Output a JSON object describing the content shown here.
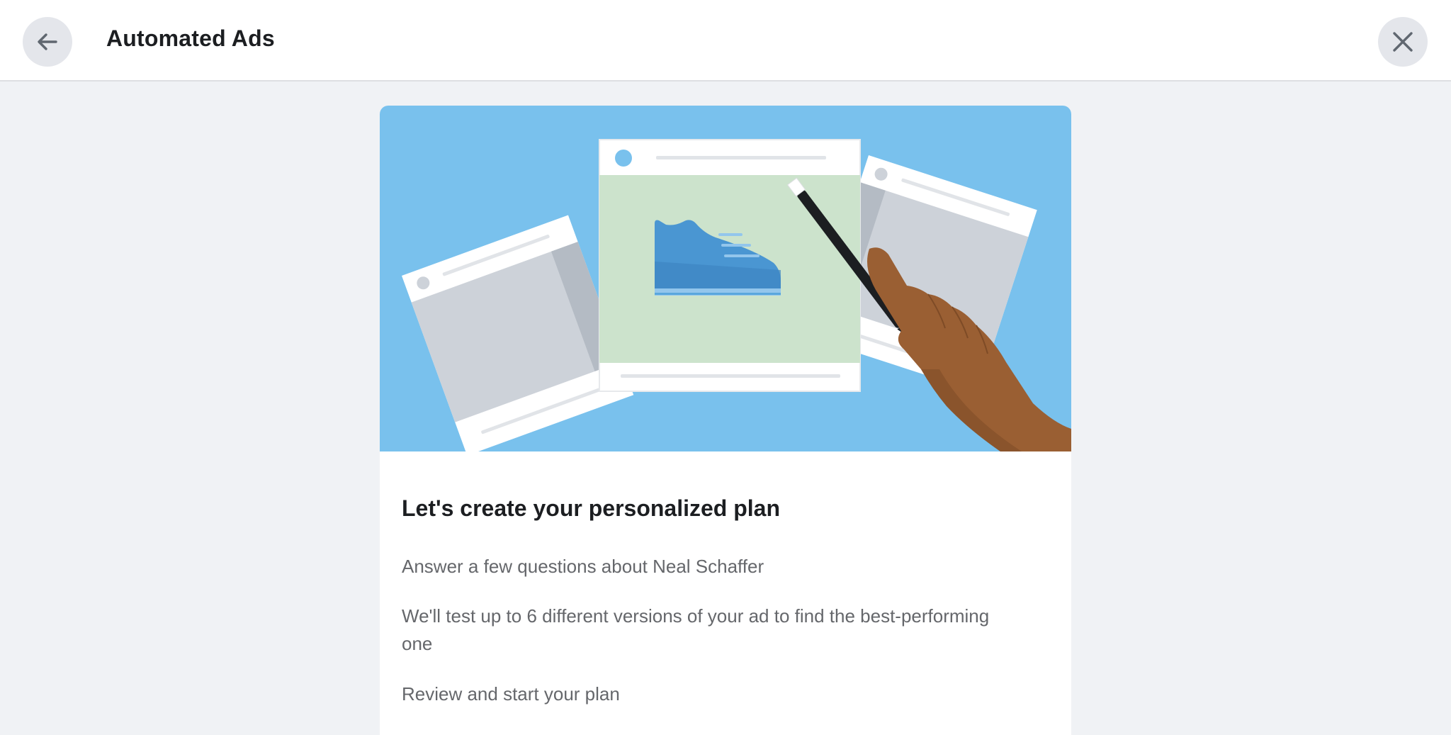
{
  "header": {
    "title": "Automated Ads",
    "back_icon": "arrow-left-icon",
    "close_icon": "close-icon"
  },
  "hero": {
    "illustration": "ad-versions-illustration",
    "background_color": "#79c1ed"
  },
  "card": {
    "title": "Let's create your personalized plan",
    "steps": [
      "Answer a few questions about Neal Schaffer",
      "We'll test up to 6 different versions of your ad to find the best-performing one",
      "Review and start your plan"
    ]
  },
  "colors": {
    "page_background": "#f0f2f5",
    "header_background": "#ffffff",
    "button_background": "#e4e6eb",
    "title_text": "#1c1e21",
    "body_text": "#65676b"
  }
}
